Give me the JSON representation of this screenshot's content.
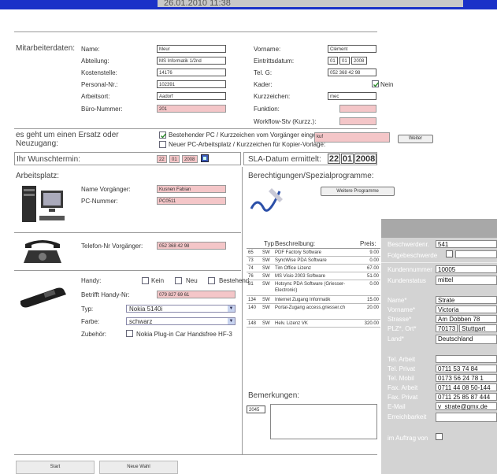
{
  "header": {
    "timestamp": "26.01.2010 11:38"
  },
  "employee": {
    "section_label": "Mitarbeiterdaten:",
    "fields": [
      {
        "label": "Name:",
        "value": "Meur"
      },
      {
        "label": "Abteilung:",
        "value": "MS Informatik 1/2nd"
      },
      {
        "label": "Kostenstelle:",
        "value": "14176"
      },
      {
        "label": "Personal-Nr.:",
        "value": "102391"
      },
      {
        "label": "Arbeitsort:",
        "value": "Aadorf"
      },
      {
        "label": "Büro-Nummer:",
        "value": "201"
      }
    ],
    "right_fields": [
      {
        "label": "Vorname:",
        "value": "Clément"
      },
      {
        "label": "Eintrittsdatum:",
        "day": "01",
        "month": "01",
        "year": "2008"
      },
      {
        "label": "Tel. G:",
        "value": "052 368 42 98"
      },
      {
        "label": "Kader:",
        "checkbox_label": "Nein"
      },
      {
        "label": "Kurzzeichen:",
        "value": "mec"
      },
      {
        "label": "Funktion:",
        "value": ""
      },
      {
        "label": "Workflow-Stv (Kurzz.):",
        "value": ""
      }
    ]
  },
  "replacement": {
    "question": "es geht um einen Ersatz oder Neuzugang:",
    "option_existing": "Bestehender PC / Kurzzeichen vom Vorgänger eingeben:",
    "option_new": "Neuer PC-Arbeitsplatz / Kurzzeichen für Kopier-Vorlage:",
    "input_value": "kuf",
    "next_button": "Weiter"
  },
  "dates": {
    "wish_label": "Ihr Wunschtermin:",
    "wish_day": "22",
    "wish_month": "01",
    "wish_year": "2008",
    "sla_label": "SLA-Datum ermittelt:",
    "sla_day": "22",
    "sla_month": "01",
    "sla_year": "2008"
  },
  "workplace": {
    "section_label": "Arbeitsplatz:",
    "predecessor_label": "Name Vorgänger:",
    "predecessor_value": "Kusnen Fabian",
    "pc_label": "PC-Nummer:",
    "pc_value": "PC0511",
    "phone_label": "Telefon-Nr Vorgänger:",
    "phone_value": "052 368 42 98",
    "mobile_label": "Handy:",
    "mobile_options": [
      "Kein",
      "Neu",
      "Bestehend"
    ],
    "mobile_predecessor_label": "Betrifft Handy-Nr:",
    "mobile_predecessor_value": "079 827 69 61",
    "type_label": "Typ:",
    "type_value": "Nokia 5140i",
    "color_label": "Farbe:",
    "color_value": "schwarz",
    "accessory_label": "Zubehör:",
    "accessory_value": "Nokia Plug-in Car Handsfree HF-3"
  },
  "permissions": {
    "section_label": "Berechtigungen/Spezialprogramme:",
    "more_button": "Weitere Programme",
    "columns": [
      "Typ",
      "Beschreibung:",
      "Preis:"
    ],
    "rows": [
      {
        "id": "65",
        "type": "SW",
        "desc": "PDF Factory Software",
        "price": "9.00"
      },
      {
        "id": "73",
        "type": "SW",
        "desc": "SyncWise PDA Software",
        "price": "0.00"
      },
      {
        "id": "74",
        "type": "SW",
        "desc": "Tim Office Lizenz",
        "price": "67.00"
      },
      {
        "id": "76",
        "type": "SW",
        "desc": "MS Visio 2003 Software",
        "price": "51.00"
      },
      {
        "id": "81",
        "type": "SW",
        "desc": "Hotsync PDA Software (Griesser-Electronic)",
        "price": "0.00"
      },
      {
        "id": "134",
        "type": "SW",
        "desc": "Internet Zugang Informatik",
        "price": "15.00"
      },
      {
        "id": "140",
        "type": "SW",
        "desc": "Portal-Zugang access.griesser.ch",
        "price": "20.00"
      },
      {
        "id": "148",
        "type": "SW",
        "desc": "Helv. Lizenz VK",
        "price": "320.00"
      }
    ]
  },
  "remarks": {
    "label": "Bemerkungen:",
    "id": "2045"
  },
  "complaint_panel": {
    "fields": [
      {
        "label": "Beschwerdenr.",
        "value": "541"
      },
      {
        "label": "Folgebeschwerde",
        "value": ""
      },
      {
        "label": "Kundennummer",
        "value": "10005"
      },
      {
        "label": "Kundenstatus",
        "value": "mittel"
      },
      {
        "label": "Name*",
        "value": "Strate"
      },
      {
        "label": "Vorname*",
        "value": "Victoria"
      },
      {
        "label": "Strasse*",
        "value": "Am Dobben 78"
      },
      {
        "label": "PLZ*, Ort*",
        "value": "70173",
        "value2": "Stuttgart"
      },
      {
        "label": "Land*",
        "value": "Deutschland"
      },
      {
        "label": "Tel. Arbeit",
        "value": ""
      },
      {
        "label": "Tel. Privat",
        "value": "0711 53 74 84"
      },
      {
        "label": "Tel. Mobil",
        "value": "0173 56 24 78 1"
      },
      {
        "label": "Fax. Arbeit",
        "value": "0711 44 08 50-144"
      },
      {
        "label": "Fax. Privat",
        "value": "0711 25 85 87 444"
      },
      {
        "label": "E-Mail",
        "value": "v_strate@gmx.de"
      },
      {
        "label": "Erreichbarkeit",
        "value": ""
      },
      {
        "label": "im Auftrag von",
        "value": ""
      }
    ]
  },
  "footer": {
    "start_button": "Start",
    "new_button": "Neue Wahl"
  },
  "colors": {
    "topbar": "#1a31c8",
    "pink_field": "#f4c6c8",
    "panel_bg": "#d3d3d3"
  }
}
